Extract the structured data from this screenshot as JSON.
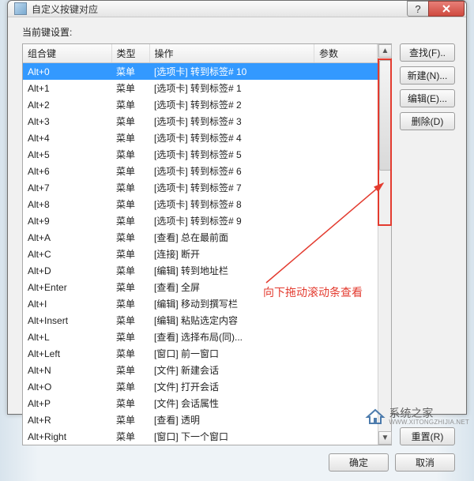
{
  "window": {
    "title": "自定义按键对应",
    "section_label": "当前键设置:"
  },
  "buttons": {
    "find": "查找(F)..",
    "new": "新建(N)...",
    "edit": "编辑(E)...",
    "delete": "删除(D)",
    "reset": "重置(R)",
    "ok": "确定",
    "cancel": "取消"
  },
  "columns": {
    "key": "组合键",
    "type": "类型",
    "op": "操作",
    "param": "参数"
  },
  "rows": [
    {
      "key": "Alt+0",
      "type": "菜单",
      "op": "[选项卡] 转到标签# 10"
    },
    {
      "key": "Alt+1",
      "type": "菜单",
      "op": "[选项卡] 转到标签# 1"
    },
    {
      "key": "Alt+2",
      "type": "菜单",
      "op": "[选项卡] 转到标签# 2"
    },
    {
      "key": "Alt+3",
      "type": "菜单",
      "op": "[选项卡] 转到标签# 3"
    },
    {
      "key": "Alt+4",
      "type": "菜单",
      "op": "[选项卡] 转到标签# 4"
    },
    {
      "key": "Alt+5",
      "type": "菜单",
      "op": "[选项卡] 转到标签# 5"
    },
    {
      "key": "Alt+6",
      "type": "菜单",
      "op": "[选项卡] 转到标签# 6"
    },
    {
      "key": "Alt+7",
      "type": "菜单",
      "op": "[选项卡] 转到标签# 7"
    },
    {
      "key": "Alt+8",
      "type": "菜单",
      "op": "[选项卡] 转到标签# 8"
    },
    {
      "key": "Alt+9",
      "type": "菜单",
      "op": "[选项卡] 转到标签# 9"
    },
    {
      "key": "Alt+A",
      "type": "菜单",
      "op": "[查看] 总在最前面"
    },
    {
      "key": "Alt+C",
      "type": "菜单",
      "op": "[连接] 断开"
    },
    {
      "key": "Alt+D",
      "type": "菜单",
      "op": "[编辑] 转到地址栏"
    },
    {
      "key": "Alt+Enter",
      "type": "菜单",
      "op": "[查看] 全屏"
    },
    {
      "key": "Alt+I",
      "type": "菜单",
      "op": "[编辑] 移动到撰写栏"
    },
    {
      "key": "Alt+Insert",
      "type": "菜单",
      "op": "[编辑] 粘贴选定内容"
    },
    {
      "key": "Alt+L",
      "type": "菜单",
      "op": "[查看] 选择布局(同)..."
    },
    {
      "key": "Alt+Left",
      "type": "菜单",
      "op": "[窗口] 前一窗口"
    },
    {
      "key": "Alt+N",
      "type": "菜单",
      "op": "[文件] 新建会话"
    },
    {
      "key": "Alt+O",
      "type": "菜单",
      "op": "[文件] 打开会话"
    },
    {
      "key": "Alt+P",
      "type": "菜单",
      "op": "[文件] 会话属性"
    },
    {
      "key": "Alt+R",
      "type": "菜单",
      "op": "[查看] 透明"
    },
    {
      "key": "Alt+Right",
      "type": "菜单",
      "op": "[窗口] 下一个窗口"
    }
  ],
  "annotation": "向下拖动滚动条查看",
  "watermark": {
    "brand": "系统之家",
    "url": "WWW.XITONGZHIJIA.NET"
  }
}
